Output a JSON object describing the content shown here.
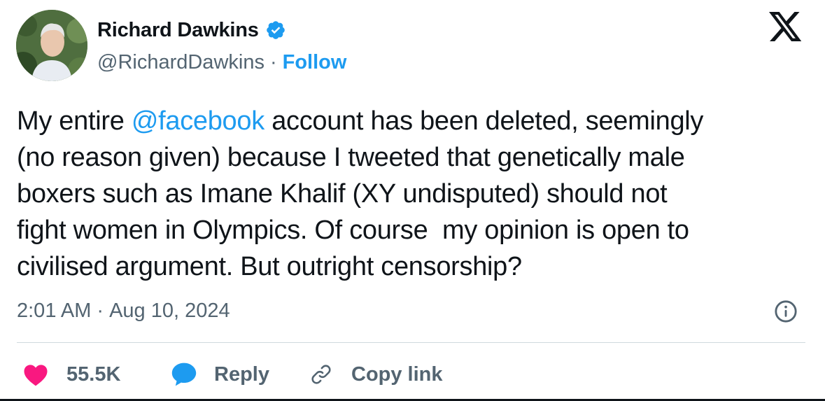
{
  "author": {
    "display_name": "Richard Dawkins",
    "handle": "@RichardDawkins",
    "separator": "·",
    "follow_label": "Follow",
    "verified": true
  },
  "tweet": {
    "text_before": "My entire ",
    "mention": "@facebook",
    "text_after": " account has been deleted, seemingly\n(no reason given) because I tweeted that genetically male\nboxers such as Imane Khalif (XY undisputed) should not\nfight women in Olympics. Of course  my opinion is open to\ncivilised argument. But outright censorship?",
    "time": "2:01 AM",
    "separator": "·",
    "date": "Aug 10, 2024"
  },
  "actions": {
    "like_count": "55.5K",
    "reply_label": "Reply",
    "copy_link_label": "Copy link"
  },
  "icons": {
    "platform_logo": "x-logo-icon",
    "verified": "verified-badge-icon",
    "info": "info-icon",
    "like": "heart-icon",
    "reply": "speech-bubble-icon",
    "copy_link": "link-icon"
  },
  "colors": {
    "accent": "#1d9bf0",
    "like": "#f91880",
    "text": "#0f1419",
    "secondary": "#536471",
    "divider": "#cfd9de"
  }
}
